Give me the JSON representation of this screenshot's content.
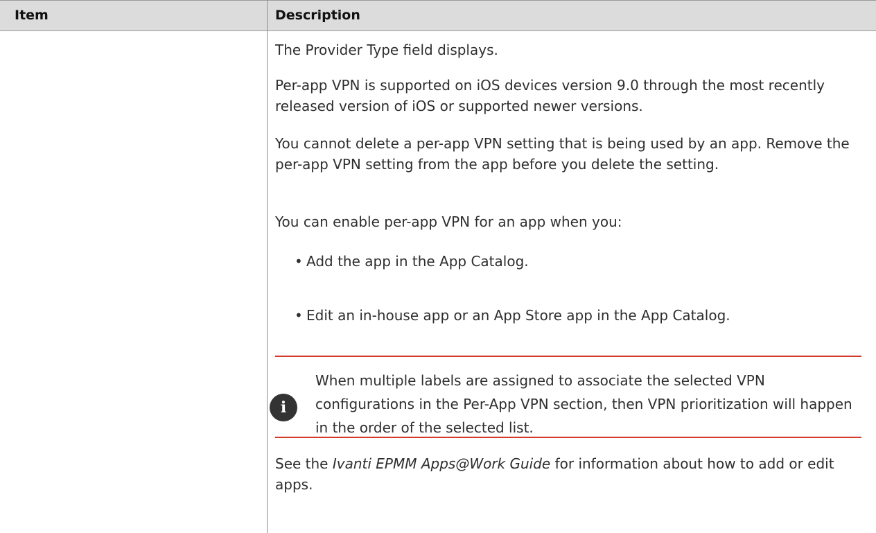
{
  "table": {
    "header": {
      "item": "Item",
      "description": "Description"
    },
    "row": {
      "paragraphs": [
        "The Provider Type field displays.",
        "Per-app VPN is supported on iOS devices version 9.0 through the most recently released version of iOS or supported newer versions.",
        "You cannot delete a per-app VPN setting that is being used by an app. Remove the per-app VPN setting from the app before you delete the setting.",
        "You can enable per-app VPN for an app when you:"
      ],
      "bullets": [
        "Add the app in the App Catalog.",
        "Edit an in-house app or an App Store app in the App Catalog."
      ],
      "note": {
        "icon": "info-icon",
        "text": "When multiple labels are assigned to associate the selected VPN configurations in the Per-App VPN section, then VPN prioritization will happen in the order of the selected list."
      },
      "see_also": {
        "prefix": "See the ",
        "guide": "Ivanti EPMM Apps@Work Guide",
        "suffix": " for information about how to add or edit apps."
      }
    }
  },
  "colors": {
    "header_bg": "#dcdcdc",
    "rule": "#d43a2c",
    "icon_bg": "#333333"
  }
}
